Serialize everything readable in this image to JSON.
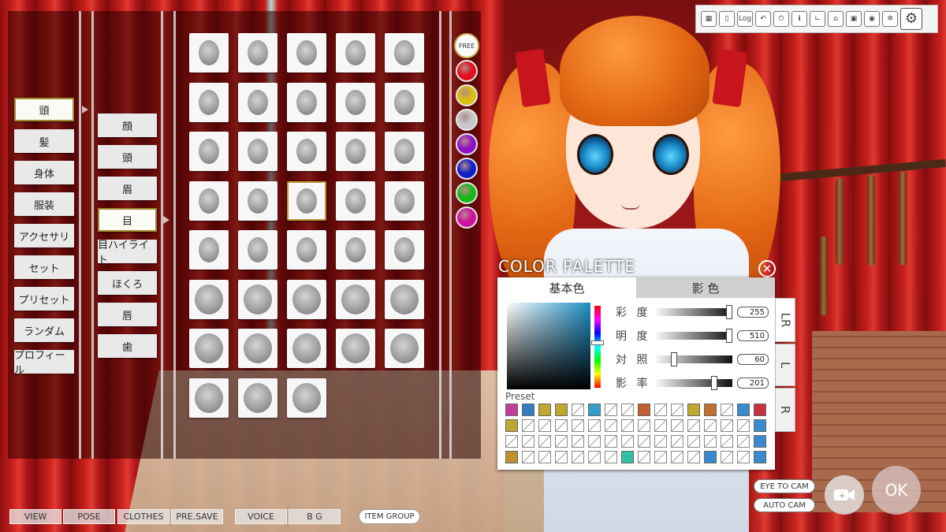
{
  "toolbar": {
    "buttons": [
      {
        "name": "capture-card-icon",
        "label": ""
      },
      {
        "name": "phone-icon",
        "label": ""
      },
      {
        "name": "log-button",
        "label": "Log"
      },
      {
        "name": "undo-icon",
        "label": ""
      },
      {
        "name": "power-icon",
        "label": ""
      },
      {
        "name": "info-icon",
        "label": ""
      },
      {
        "name": "axis-icon",
        "label": ""
      },
      {
        "name": "basket-icon",
        "label": ""
      },
      {
        "name": "save-card-icon",
        "label": ""
      },
      {
        "name": "screenshot-icon",
        "label": ""
      },
      {
        "name": "gears-icon",
        "label": ""
      },
      {
        "name": "settings-icon",
        "label": ""
      }
    ]
  },
  "categories": [
    {
      "label": "頭",
      "active": true
    },
    {
      "label": "髪",
      "active": false
    },
    {
      "label": "身体",
      "active": false
    },
    {
      "label": "服装",
      "active": false
    },
    {
      "label": "アクセサリ",
      "active": false
    },
    {
      "label": "セット",
      "active": false
    },
    {
      "label": "プリセット",
      "active": false
    },
    {
      "label": "ランダム",
      "active": false
    },
    {
      "label": "プロフィール",
      "active": false
    }
  ],
  "subcategories": [
    {
      "label": "顔",
      "active": false
    },
    {
      "label": "頭",
      "active": false
    },
    {
      "label": "眉",
      "active": false
    },
    {
      "label": "目",
      "active": true
    },
    {
      "label": "目ハイライト",
      "active": false
    },
    {
      "label": "ほくろ",
      "active": false
    },
    {
      "label": "唇",
      "active": false
    },
    {
      "label": "歯",
      "active": false
    }
  ],
  "eye_grid": {
    "count": 38,
    "selected_index": 17
  },
  "color_swatches": {
    "free_label": "FREE",
    "colors": [
      "#e0101c",
      "#d8c010",
      "#c8c8c8",
      "#9010c8",
      "#1020c8",
      "#18b818",
      "#d010a0"
    ]
  },
  "palette": {
    "title": "COLOR PALETTE",
    "tab_base": "基本色",
    "tab_shadow": "影 色",
    "sliders": [
      {
        "label": "彩 度",
        "value": "255",
        "level": 1.0
      },
      {
        "label": "明 度",
        "value": "510",
        "level": 1.0
      },
      {
        "label": "対 照",
        "value": "60",
        "level": 0.24
      },
      {
        "label": "影 率",
        "value": "201",
        "level": 0.79
      }
    ],
    "preset_label": "Preset",
    "preset_rows": [
      [
        "#c43c9a",
        "#2f7fc0",
        "#c0a830",
        "#c0a830",
        "",
        "#2fa0c8",
        "",
        "",
        "#c06030",
        "",
        "",
        "#c0a830",
        "#c07030",
        "",
        "#3a8ad0",
        "#c83040"
      ],
      [
        "#c0a830",
        "",
        "",
        "",
        "",
        "",
        "",
        "",
        "",
        "",
        "",
        "",
        "",
        "",
        "",
        "#3a8ad0"
      ],
      [
        "",
        "",
        "",
        "",
        "",
        "",
        "",
        "",
        "",
        "",
        "",
        "",
        "",
        "",
        "",
        "#3a8ad0"
      ],
      [
        "#c09030",
        "",
        "",
        "",
        "",
        "",
        "",
        "#30c0a8",
        "",
        "",
        "",
        "",
        "#3a8ad0",
        "",
        "",
        "#3a8ad0"
      ]
    ],
    "side_tabs": [
      "LR",
      "L",
      "R"
    ]
  },
  "bottom_nav": [
    "VIEW",
    "POSE",
    "CLOTHES",
    "PRE.SAVE",
    "VOICE",
    "B G"
  ],
  "item_group_label": "ITEM GROUP",
  "camera": {
    "eye_to_cam": "EYE TO CAM",
    "auto_cam": "AUTO CAM"
  },
  "ok_label": "OK"
}
